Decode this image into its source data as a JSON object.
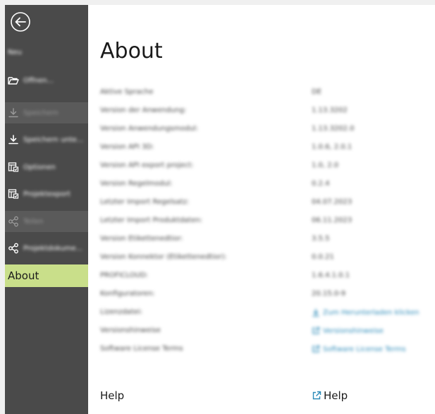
{
  "sidebar": {
    "items": [
      {
        "label": "Neu",
        "icon": "new-icon"
      },
      {
        "label": "Öffnen...",
        "icon": "folder-open-icon"
      },
      {
        "label": "Speichern",
        "icon": "save-icon"
      },
      {
        "label": "Speichern unte...",
        "icon": "save-as-icon"
      },
      {
        "label": "Optionen",
        "icon": "options-icon"
      },
      {
        "label": "Projektexport",
        "icon": "project-export-icon"
      },
      {
        "label": "Teilen",
        "icon": "share-icon"
      },
      {
        "label": "Projektdokume...",
        "icon": "share-project-icon"
      },
      {
        "label": "About",
        "icon": ""
      }
    ]
  },
  "page": {
    "title": "About"
  },
  "info_rows": [
    {
      "key": "Aktive Sprache",
      "value": "DE"
    },
    {
      "key": "Version der Anwendung:",
      "value": "1.13.3202"
    },
    {
      "key": "Version Anwendungsmodul:",
      "value": "1.13.3202.0"
    },
    {
      "key": "Version API 3D:",
      "value": "1.0.6, 2.0.1"
    },
    {
      "key": "Version API export project:",
      "value": "1.0, 2.0"
    },
    {
      "key": "Version Regelmodul:",
      "value": "0.2.4"
    },
    {
      "key": "Letzter Import Regelsatz:",
      "value": "04.07.2023"
    },
    {
      "key": "Letzter Import Produktdaten:",
      "value": "06.11.2023"
    },
    {
      "key": "Version Etikettenedtior:",
      "value": "3.5.5"
    },
    {
      "key": "Version Konnektor (Etikettenedtior):",
      "value": "0.0.21"
    },
    {
      "key": "PROFICLOUD:",
      "value": "1.6.4.1.0.1"
    },
    {
      "key": "Konfiguratoren:",
      "value": "20.15.0-9"
    },
    {
      "key": "Lizenzdatei:",
      "value": "Zum Herunterladen klicken"
    },
    {
      "key": "Versionshinweise",
      "value": "Versionshinweise"
    },
    {
      "key": "Software License Terms",
      "value": "Software License Terms"
    },
    {
      "key": "Help",
      "value": "Help"
    }
  ],
  "colors": {
    "sidebar_bg": "#4a4a4a",
    "active_item_bg": "#c9df8a",
    "link": "#2b8ab8"
  }
}
